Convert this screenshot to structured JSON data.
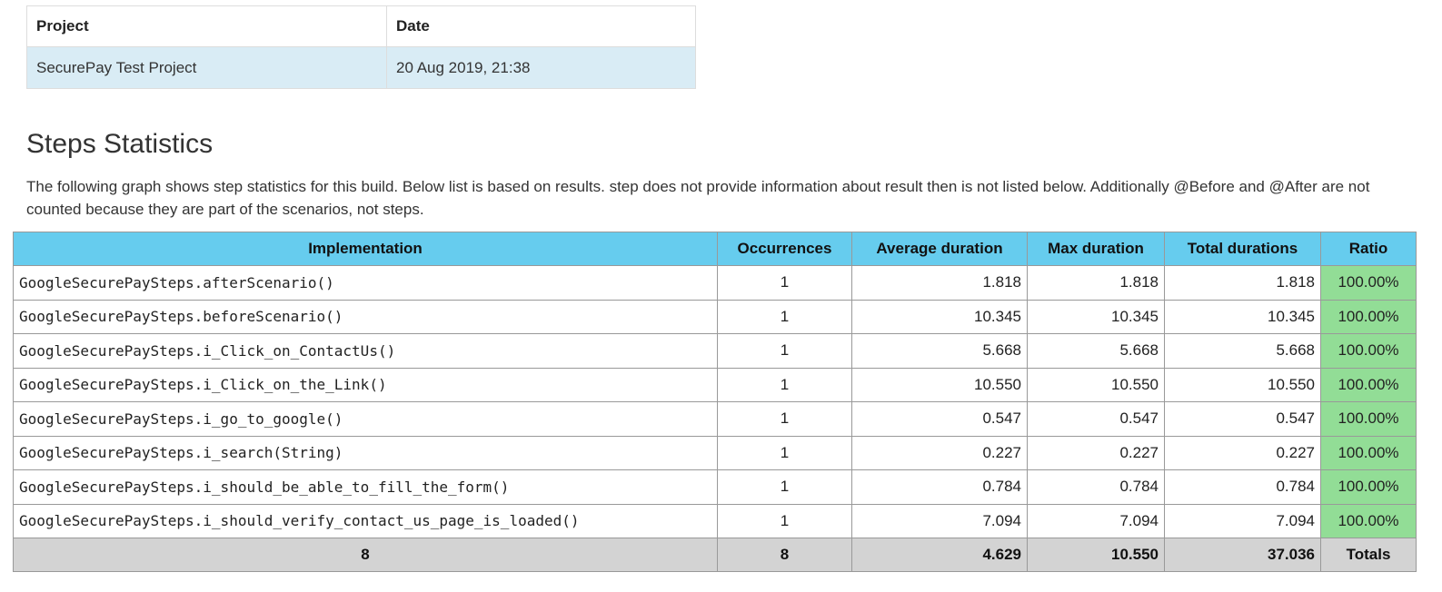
{
  "project_info": {
    "headers": [
      "Project",
      "Date"
    ],
    "project": "SecurePay Test Project",
    "date": "20 Aug 2019, 21:38"
  },
  "section": {
    "title": "Steps Statistics",
    "description": "The following graph shows step statistics for this build. Below list is based on results. step does not provide information about result then is not listed below. Additionally @Before and @After are not counted because they are part of the scenarios, not steps."
  },
  "steps_table": {
    "headers": [
      "Implementation",
      "Occurrences",
      "Average duration",
      "Max duration",
      "Total durations",
      "Ratio"
    ],
    "rows": [
      {
        "implementation": "GoogleSecurePaySteps.afterScenario()",
        "occurrences": "1",
        "average": "1.818",
        "max": "1.818",
        "total": "1.818",
        "ratio": "100.00%"
      },
      {
        "implementation": "GoogleSecurePaySteps.beforeScenario()",
        "occurrences": "1",
        "average": "10.345",
        "max": "10.345",
        "total": "10.345",
        "ratio": "100.00%"
      },
      {
        "implementation": "GoogleSecurePaySteps.i_Click_on_ContactUs()",
        "occurrences": "1",
        "average": "5.668",
        "max": "5.668",
        "total": "5.668",
        "ratio": "100.00%"
      },
      {
        "implementation": "GoogleSecurePaySteps.i_Click_on_the_Link()",
        "occurrences": "1",
        "average": "10.550",
        "max": "10.550",
        "total": "10.550",
        "ratio": "100.00%"
      },
      {
        "implementation": "GoogleSecurePaySteps.i_go_to_google()",
        "occurrences": "1",
        "average": "0.547",
        "max": "0.547",
        "total": "0.547",
        "ratio": "100.00%"
      },
      {
        "implementation": "GoogleSecurePaySteps.i_search(String)",
        "occurrences": "1",
        "average": "0.227",
        "max": "0.227",
        "total": "0.227",
        "ratio": "100.00%"
      },
      {
        "implementation": "GoogleSecurePaySteps.i_should_be_able_to_fill_the_form()",
        "occurrences": "1",
        "average": "0.784",
        "max": "0.784",
        "total": "0.784",
        "ratio": "100.00%"
      },
      {
        "implementation": "GoogleSecurePaySteps.i_should_verify_contact_us_page_is_loaded()",
        "occurrences": "1",
        "average": "7.094",
        "max": "7.094",
        "total": "7.094",
        "ratio": "100.00%"
      }
    ],
    "totals": {
      "implementation": "8",
      "occurrences": "8",
      "average": "4.629",
      "max": "10.550",
      "total": "37.036",
      "ratio": "Totals"
    }
  },
  "colors": {
    "header_bg": "#66ccee",
    "ratio_bg": "#92dd96",
    "totals_bg": "#d3d3d3",
    "project_row_bg": "#d9ecf5"
  }
}
